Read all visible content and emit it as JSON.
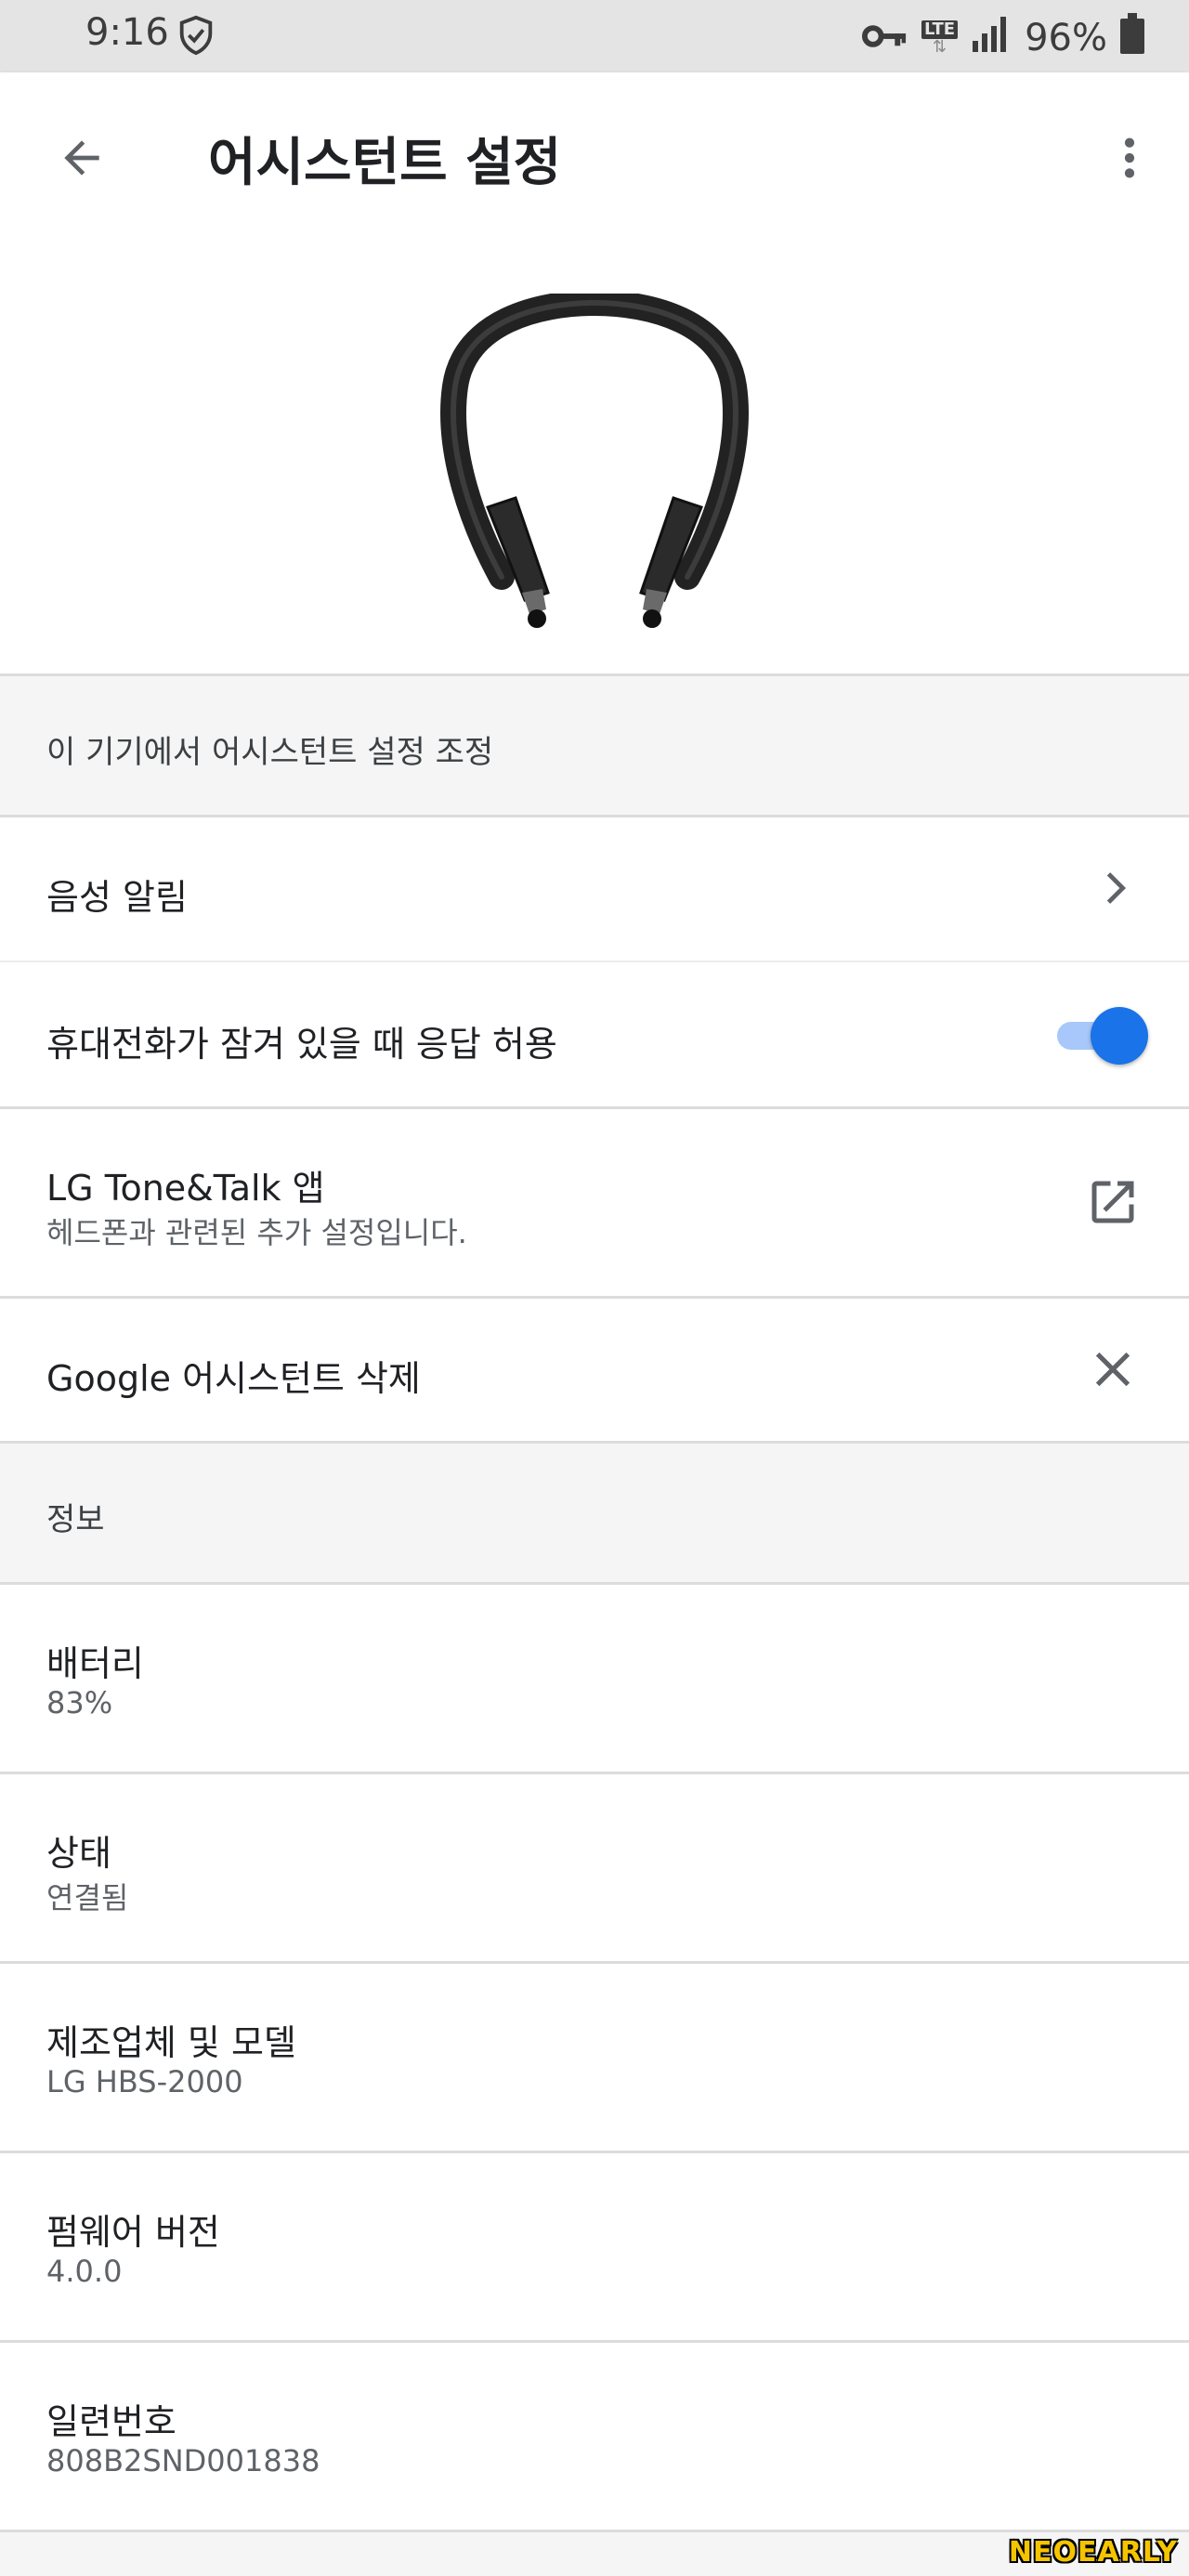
{
  "status_bar": {
    "time": "9:16",
    "battery_percent": "96%",
    "network_label": "LTE"
  },
  "app_bar": {
    "title": "어시스턴트 설정"
  },
  "section_device": {
    "header": "이 기기에서 어시스턴트 설정 조정",
    "items": [
      {
        "title": "음성 알림",
        "trailing": "chevron-right-icon"
      },
      {
        "title": "휴대전화가 잠겨 있을 때 응답 허용",
        "trailing": "toggle",
        "toggle_on": true
      },
      {
        "title": "LG Tone&Talk 앱",
        "subtitle": "헤드폰과 관련된 추가 설정입니다.",
        "trailing": "open-in-new-icon"
      },
      {
        "title": "Google 어시스턴트 삭제",
        "trailing": "close-icon"
      }
    ]
  },
  "section_info": {
    "header": "정보",
    "items": [
      {
        "title": "배터리",
        "value": "83%"
      },
      {
        "title": "상태",
        "value": "연결됨"
      },
      {
        "title": "제조업체 및 모델",
        "value": "LG HBS-2000"
      },
      {
        "title": "펌웨어 버전",
        "value": "4.0.0"
      },
      {
        "title": "일련번호",
        "value": "808B2SND001838"
      }
    ]
  },
  "watermark": "NEOEARLY",
  "colors": {
    "accent": "#1a73e8",
    "toggle_track": "#a8c7fa",
    "status_bar_bg": "#e4e4e4",
    "section_bg": "#f5f5f5",
    "divider": "#dcdcdc"
  }
}
